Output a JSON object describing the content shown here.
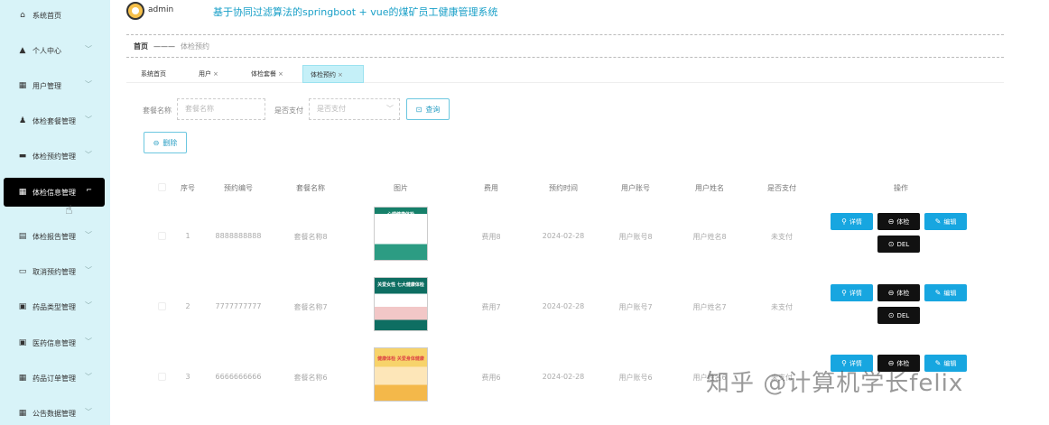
{
  "header": {
    "username": "admin",
    "system_title": "基于协同过滤算法的springboot + vue的煤矿员工健康管理系统"
  },
  "sidebar": {
    "items": [
      {
        "label": "系统首页",
        "icon": "home-icon",
        "glyph": "⌂",
        "has_chevron": false,
        "active": false
      },
      {
        "label": "个人中心",
        "icon": "user-icon",
        "glyph": "▲",
        "has_chevron": true,
        "active": false
      },
      {
        "label": "用户管理",
        "icon": "grid-icon",
        "glyph": "▦",
        "has_chevron": true,
        "active": false
      },
      {
        "label": "体检套餐管理",
        "icon": "person-icon",
        "glyph": "♟",
        "has_chevron": true,
        "active": false
      },
      {
        "label": "体检预约管理",
        "icon": "briefcase-icon",
        "glyph": "▬",
        "has_chevron": true,
        "active": false
      },
      {
        "label": "体检信息管理",
        "icon": "grid-icon",
        "glyph": "▦",
        "has_chevron": true,
        "active": true
      },
      {
        "label": "体检报告管理",
        "icon": "document-icon",
        "glyph": "▤",
        "has_chevron": true,
        "active": false
      },
      {
        "label": "取消预约管理",
        "icon": "monitor-icon",
        "glyph": "▭",
        "has_chevron": true,
        "active": false
      },
      {
        "label": "药品类型管理",
        "icon": "clipboard-icon",
        "glyph": "▣",
        "has_chevron": true,
        "active": false
      },
      {
        "label": "医药信息管理",
        "icon": "calendar-icon",
        "glyph": "▣",
        "has_chevron": true,
        "active": false
      },
      {
        "label": "药品订单管理",
        "icon": "grid-icon",
        "glyph": "▦",
        "has_chevron": true,
        "active": false
      },
      {
        "label": "公告数据管理",
        "icon": "grid-icon",
        "glyph": "▦",
        "has_chevron": true,
        "active": false
      }
    ]
  },
  "breadcrumb": {
    "home": "首页",
    "separator": "———",
    "current": "体检预约"
  },
  "tabs": [
    {
      "label": "系统首页",
      "closable": false,
      "active": false
    },
    {
      "label": "用户",
      "closable": true,
      "active": false
    },
    {
      "label": "体检套餐",
      "closable": true,
      "active": false
    },
    {
      "label": "体检预约",
      "closable": true,
      "active": true
    }
  ],
  "search": {
    "package_label": "套餐名称",
    "package_placeholder": "套餐名称",
    "paid_label": "是否支付",
    "paid_placeholder": "是否支付",
    "query_label": "查询",
    "query_icon_glyph": "⊡"
  },
  "delete_button": {
    "label": "删除",
    "icon_glyph": "⊖"
  },
  "table": {
    "columns": [
      "序号",
      "预约编号",
      "套餐名称",
      "图片",
      "费用",
      "预约时间",
      "用户账号",
      "用户姓名",
      "是否支付",
      "操作"
    ],
    "rows": [
      {
        "index": "1",
        "booking_no": "8888888888",
        "package": "套餐名称8",
        "fee": "费用8",
        "time": "2024-02-28",
        "account": "用户账号8",
        "name": "用户姓名8",
        "paid": "未支付",
        "thumb_text": "心理健康体检"
      },
      {
        "index": "2",
        "booking_no": "7777777777",
        "package": "套餐名称7",
        "fee": "费用7",
        "time": "2024-02-28",
        "account": "用户账号7",
        "name": "用户姓名7",
        "paid": "未支付",
        "thumb_text": "关爱女性 七大健康体检"
      },
      {
        "index": "3",
        "booking_no": "6666666666",
        "package": "套餐名称6",
        "fee": "费用6",
        "time": "2024-02-28",
        "account": "用户账号6",
        "name": "用户姓名6",
        "paid": "未支付",
        "thumb_text": "健康体检 关爱身体健康"
      }
    ],
    "actions": {
      "detail": "详情",
      "exam": "体检",
      "edit": "编辑",
      "delete": "DEL"
    }
  },
  "watermark": "知乎 @计算机学长felix",
  "colors": {
    "sidebar_bg": "#d8f3f8",
    "title_blue": "#1aa0c8",
    "action_blue": "#17a6e0",
    "active_black": "#000000"
  }
}
